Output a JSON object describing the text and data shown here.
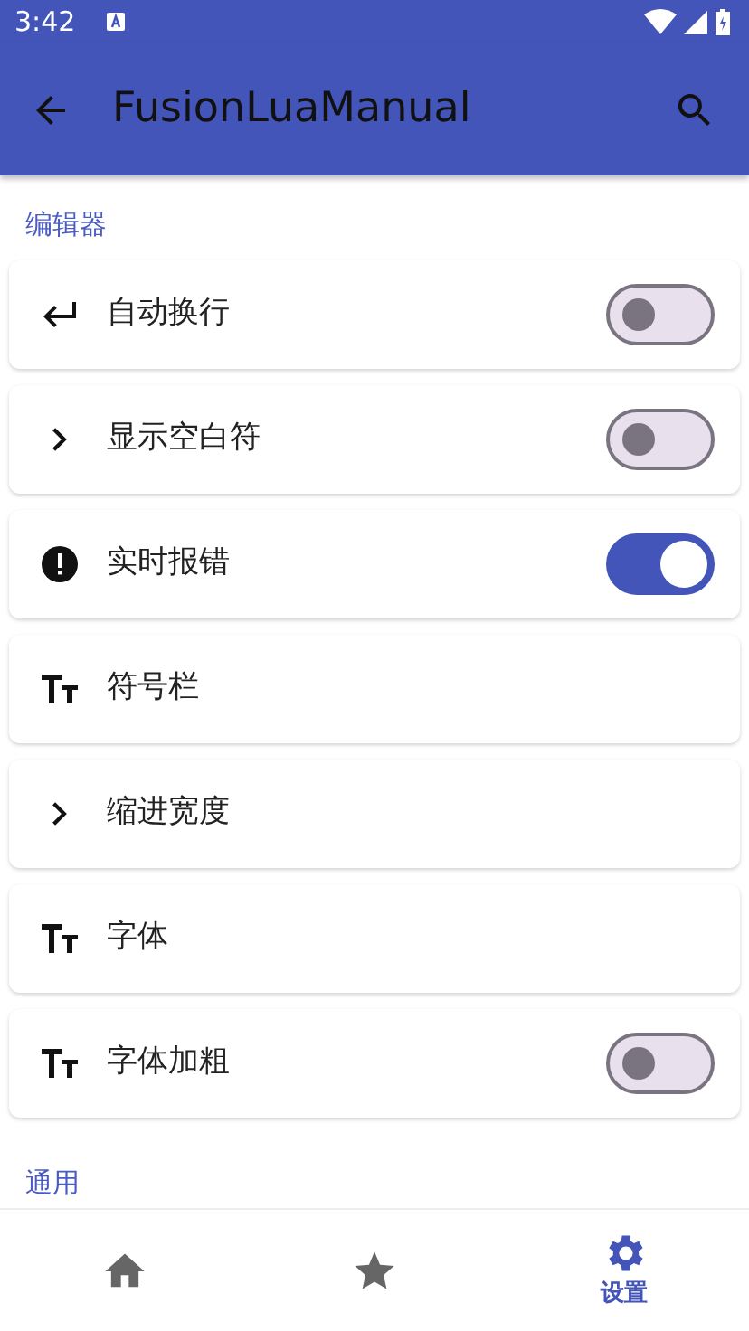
{
  "status_bar": {
    "time": "3:42"
  },
  "app_bar": {
    "title": "FusionLuaManual"
  },
  "sections": [
    {
      "title": "编辑器",
      "items": [
        {
          "label": "自动换行",
          "kind": "switch",
          "checked": false
        },
        {
          "label": "显示空白符",
          "kind": "switch",
          "checked": false
        },
        {
          "label": "实时报错",
          "kind": "switch",
          "checked": true
        },
        {
          "label": "符号栏",
          "kind": "plain"
        },
        {
          "label": "缩进宽度",
          "kind": "plain"
        },
        {
          "label": "字体",
          "kind": "plain"
        },
        {
          "label": "字体加粗",
          "kind": "switch",
          "checked": false
        }
      ]
    },
    {
      "title": "通用"
    }
  ],
  "bottom_nav": [
    {
      "selected": false
    },
    {
      "selected": false
    },
    {
      "label": "设置",
      "selected": true
    }
  ]
}
